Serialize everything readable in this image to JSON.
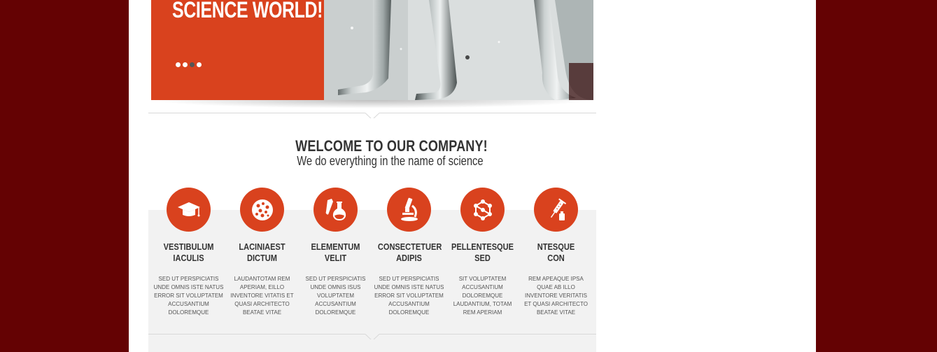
{
  "colors": {
    "background": "#640203",
    "accent": "#d9421e",
    "band": "#f2f2f2"
  },
  "hero": {
    "title": "SCIENCE WORLD!",
    "slider_dots": 4,
    "active_dot": 2
  },
  "welcome": {
    "title": "WELCOME TO OUR COMPANY!",
    "subtitle": "We do everything in the name of science"
  },
  "features": [
    {
      "icon": "graduation-cap-icon",
      "title_line1": "VESTIBULUM",
      "title_line2": "IACULIS",
      "desc": [
        "SED UT PERSPICIATIS",
        "UNDE OMNIS ISTE NATUS",
        "ERROR SIT VOLUPTATEM",
        "ACCUSANTIUM",
        "DOLOREMQUE"
      ]
    },
    {
      "icon": "cell-icon",
      "title_line1": "LACINIAEST",
      "title_line2": "DICTUM",
      "desc": [
        "LAUDANTOTAM REM",
        "APERIAM, EILLO",
        "INVENTORE VITATIS ET",
        "QUASI ARCHITECTO",
        "BEATAE VITAE"
      ]
    },
    {
      "icon": "flask-icon",
      "title_line1": "ELEMENTUM",
      "title_line2": "VELIT",
      "desc": [
        "SED UT PERSPICIATIS",
        "UNDE OMNIS ISUS",
        "VOLUPTATEM",
        "ACCUSANTIUM",
        "DOLOREMQUE"
      ]
    },
    {
      "icon": "microscope-icon",
      "title_line1": "CONSECTETUER",
      "title_line2": "ADIPIS",
      "desc": [
        "SED UT PERSPICIATIS",
        "UNDE OMNIS ISTE NATUS",
        "ERROR SIT VOLUPTATEM",
        "ACCUSANTIUM",
        "DOLOREMQUE"
      ]
    },
    {
      "icon": "molecule-icon",
      "title_line1": "PELLENTESQUE",
      "title_line2": "SED",
      "desc": [
        "SIT VOLUPTATEM",
        "ACCUSANTIUM",
        "DOLOREMQUE",
        "LAUDANTIUM, TOTAM",
        "REM APERIAM"
      ]
    },
    {
      "icon": "syringe-icon",
      "title_line1": "NTESQUE",
      "title_line2": "CON",
      "desc": [
        "REM APEAQUE IPSA",
        "QUAE AB ILLO",
        "INVENTORE VERITATIS",
        "ET QUASI ARCHITECTO",
        "BEATAE VITAE"
      ]
    }
  ]
}
